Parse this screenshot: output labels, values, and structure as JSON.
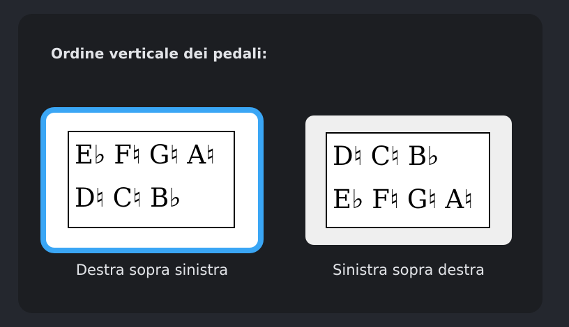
{
  "section": {
    "title": "Ordine verticale dei pedali:"
  },
  "options": [
    {
      "caption": "Destra sopra sinistra",
      "selected": true,
      "row1": "E♭ F♮ G♮ A♮",
      "row2": "D♮ C♮ B♭"
    },
    {
      "caption": "Sinistra sopra destra",
      "selected": false,
      "row1": "D♮ C♮ B♭",
      "row2": "E♭ F♮ G♮ A♮"
    }
  ],
  "colors": {
    "accent": "#3aa6f5",
    "panel_bg": "#1c1e22",
    "text": "#e2e4e8"
  }
}
